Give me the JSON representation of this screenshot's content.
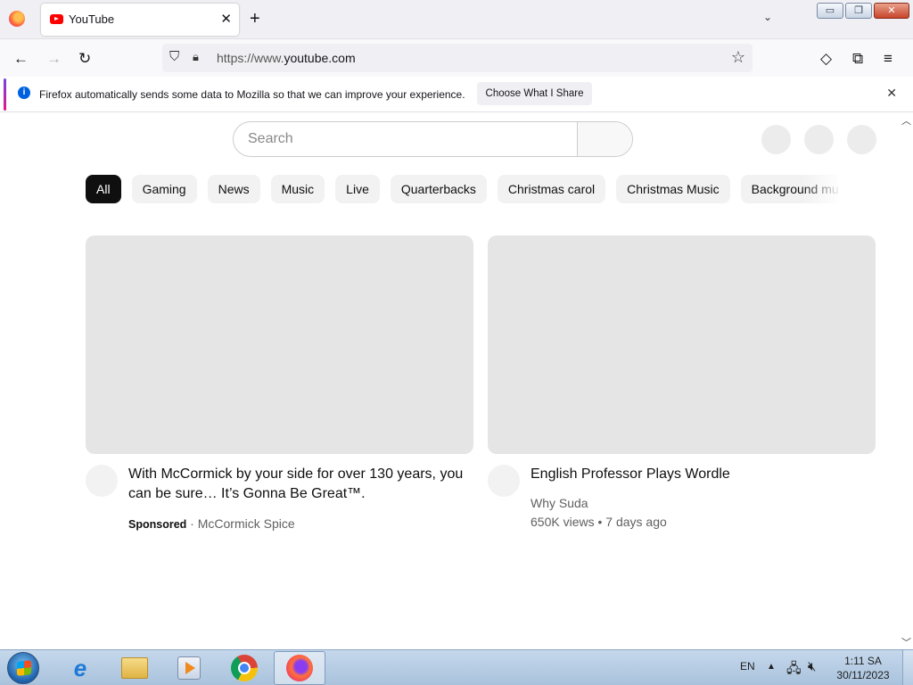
{
  "browser": {
    "tab": {
      "title": "YouTube",
      "close": "✕"
    },
    "new_tab": "+",
    "tab_list": "⌄",
    "window_buttons": {
      "minimize": "▭",
      "restore": "❐",
      "close": "✕"
    },
    "nav": {
      "back": "←",
      "forward": "→",
      "reload": "↻"
    },
    "url": {
      "prefix": "https://www.",
      "domain": "youtube.com"
    },
    "toolbar": {
      "pocket": "◇",
      "extensions": "⧉",
      "menu": "≡",
      "bookmark": "☆"
    }
  },
  "notification": {
    "text": "Firefox automatically sends some data to Mozilla so that we can improve your experience.",
    "button": "Choose What I Share",
    "close": "✕"
  },
  "youtube": {
    "search": {
      "placeholder": "Search"
    },
    "chips": [
      {
        "label": "All",
        "active": true
      },
      {
        "label": "Gaming"
      },
      {
        "label": "News"
      },
      {
        "label": "Music"
      },
      {
        "label": "Live"
      },
      {
        "label": "Quarterbacks"
      },
      {
        "label": "Christmas carol"
      },
      {
        "label": "Christmas Music"
      },
      {
        "label": "Background music"
      }
    ],
    "videos": [
      {
        "title": "With McCormick by your side for over 130 years, you can be sure… It’s Gonna Be Great™.",
        "sponsored": "Sponsored",
        "separator": " · ",
        "channel": "McCormick Spice"
      },
      {
        "title": "English Professor Plays Wordle",
        "channel": "Why Suda",
        "stats": "650K views • 7 days ago"
      }
    ]
  },
  "taskbar": {
    "apps": [
      "internet-explorer",
      "windows-explorer",
      "media-player",
      "chrome",
      "firefox"
    ],
    "active_app": "firefox",
    "language": "EN",
    "tray_arrow": "▲",
    "time": "1:11 SA",
    "date": "30/11/2023"
  }
}
